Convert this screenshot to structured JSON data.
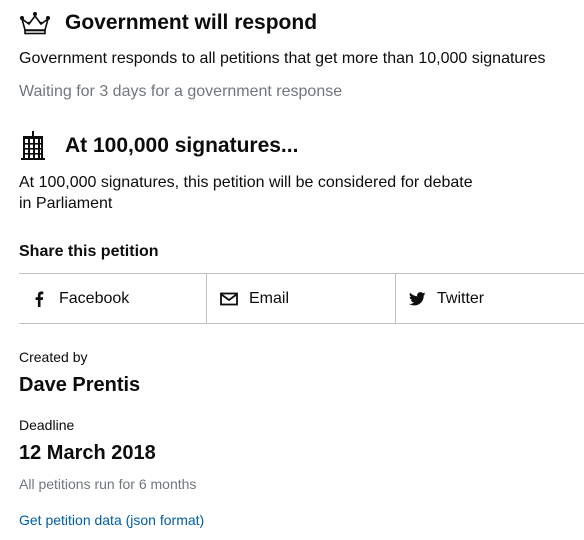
{
  "government_response": {
    "heading": "Government will respond",
    "icon": "crown-icon",
    "description": "Government responds to all petitions that get more than 10,000 signatures",
    "status": "Waiting for 3 days for a government response"
  },
  "debate": {
    "heading": "At 100,000 signatures...",
    "icon": "portcullis-icon",
    "description_line1": "At 100,000 signatures, this petition will be considered for debate",
    "description_line2": "in Parliament"
  },
  "share": {
    "title": "Share this petition",
    "items": [
      {
        "label": "Facebook",
        "icon": "facebook-icon"
      },
      {
        "label": "Email",
        "icon": "email-icon"
      },
      {
        "label": "Twitter",
        "icon": "twitter-icon"
      }
    ]
  },
  "meta": {
    "created_by_label": "Created by",
    "created_by_value": "Dave Prentis",
    "deadline_label": "Deadline",
    "deadline_value": "12 March 2018",
    "duration_note": "All petitions run for 6 months",
    "data_link": "Get petition data (json format)"
  },
  "colors": {
    "text": "#0b0c0c",
    "muted": "#6f777b",
    "link": "#005ea5",
    "border": "#bfc1c3"
  }
}
